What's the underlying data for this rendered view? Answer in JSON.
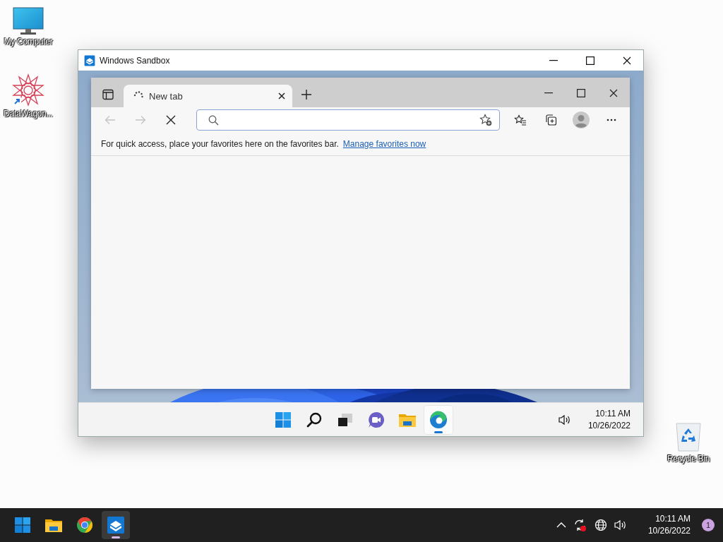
{
  "desktop_icons": [
    {
      "kind": "computer",
      "label": "My Computer"
    },
    {
      "kind": "shortcut",
      "label": "DataWagon..."
    },
    {
      "kind": "recycle-bin",
      "label": "Recycle Bin"
    }
  ],
  "sandbox_window": {
    "title": "Windows Sandbox"
  },
  "browser": {
    "tabs": [
      {
        "label": "New tab",
        "loading": true,
        "selected": true
      }
    ],
    "nav_buttons": [
      {
        "kind": "back",
        "disabled": true
      },
      {
        "kind": "forward",
        "disabled": true
      },
      {
        "kind": "stop",
        "disabled": false
      }
    ],
    "favorites_bar": {
      "message": "For quick access, place your favorites here on the favorites bar.",
      "link": "Manage favorites now"
    }
  },
  "guest_taskbar": {
    "apps": [
      {
        "kind": "start",
        "running": false
      },
      {
        "kind": "search",
        "running": false
      },
      {
        "kind": "task-view",
        "running": false
      },
      {
        "kind": "chat",
        "running": false
      },
      {
        "kind": "explorer",
        "running": false
      },
      {
        "kind": "edge",
        "running": true
      }
    ],
    "time": "10:11 AM",
    "date": "10/26/2022"
  },
  "host_taskbar": {
    "apps": [
      {
        "kind": "start",
        "running": false
      },
      {
        "kind": "explorer",
        "running": false
      },
      {
        "kind": "chrome",
        "running": false
      },
      {
        "kind": "sandbox",
        "running": true
      }
    ],
    "time": "10:11 AM",
    "date": "10/26/2022",
    "notification_count": "1"
  }
}
